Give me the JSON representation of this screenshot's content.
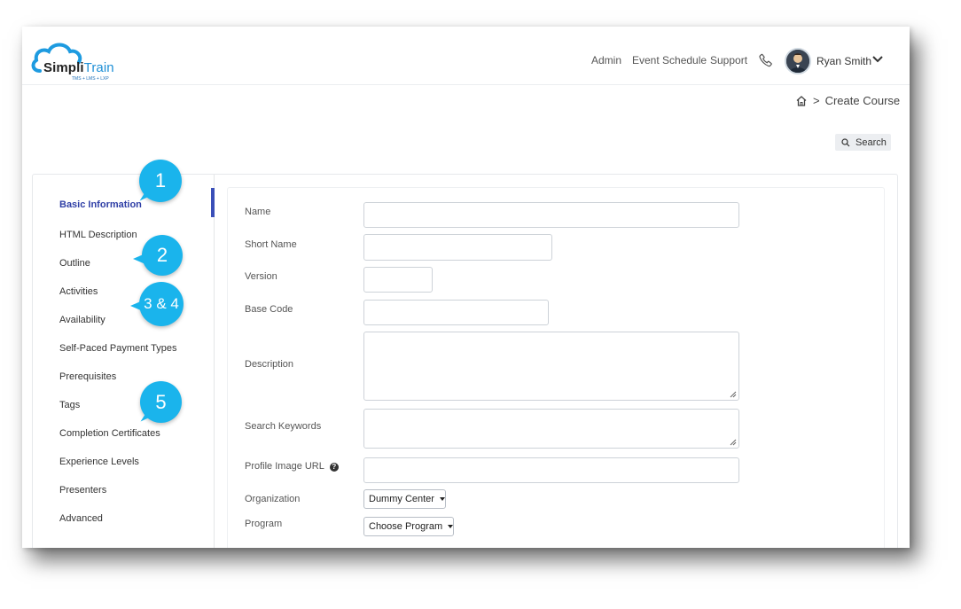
{
  "header": {
    "brand_prefix": "Simpli",
    "brand_suffix": "Train",
    "tagline": "TMS + LMS + LXP",
    "nav": [
      "Admin",
      "Event Schedule",
      "Support"
    ],
    "user_name": "Ryan Smith"
  },
  "breadcrumb": {
    "current": "Create Course"
  },
  "search": {
    "label": "Search"
  },
  "sidebar": {
    "items": [
      {
        "label": "Basic Information",
        "active": true
      },
      {
        "label": "HTML Description"
      },
      {
        "label": "Outline"
      },
      {
        "label": "Activities"
      },
      {
        "label": "Availability"
      },
      {
        "label": "Self-Paced Payment Types"
      },
      {
        "label": "Prerequisites"
      },
      {
        "label": "Tags"
      },
      {
        "label": "Completion Certificates"
      },
      {
        "label": "Experience Levels"
      },
      {
        "label": "Presenters"
      },
      {
        "label": "Advanced"
      }
    ]
  },
  "callouts": [
    "1",
    "2",
    "3 & 4",
    "5"
  ],
  "form": {
    "name": {
      "label": "Name",
      "value": ""
    },
    "short_name": {
      "label": "Short Name",
      "value": ""
    },
    "version": {
      "label": "Version",
      "value": ""
    },
    "base_code": {
      "label": "Base Code",
      "value": ""
    },
    "description": {
      "label": "Description"
    },
    "search_keywords": {
      "label": "Search Keywords"
    },
    "profile_image_url": {
      "label": "Profile Image URL",
      "value": ""
    },
    "organization": {
      "label": "Organization",
      "selected": "Dummy Center"
    },
    "program": {
      "label": "Program",
      "selected": "Choose Program"
    }
  },
  "colors": {
    "accent": "#1ab4ec",
    "active_nav": "#2f3fa6",
    "brand_blue": "#1e8fd6"
  }
}
